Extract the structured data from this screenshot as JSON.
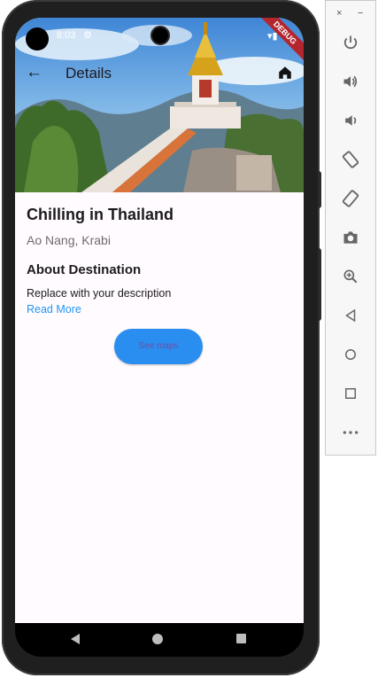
{
  "status_bar": {
    "time": "8:03",
    "gear": "⚙",
    "wifi": "▾▮"
  },
  "debug_banner": "DEBUG",
  "app_bar": {
    "title": "Details"
  },
  "destination": {
    "title": "Chilling in Thailand",
    "location": "Ao Nang, Krabi",
    "about_heading": "About Destination",
    "description": "Replace with your description",
    "read_more": "Read More",
    "maps_button": "See maps"
  },
  "colors": {
    "accent": "#2196f3",
    "button_bg": "#2a8ef0",
    "button_text": "#6c4fa3",
    "screen_bg": "#fffbfe"
  },
  "emulator_toolbar": {
    "close": "×",
    "minimize": "−",
    "icons": [
      "power-icon",
      "volume-up-icon",
      "volume-down-icon",
      "rotate-left-icon",
      "rotate-right-icon",
      "camera-icon",
      "zoom-icon",
      "back-icon",
      "home-icon",
      "overview-icon",
      "more-icon"
    ]
  }
}
